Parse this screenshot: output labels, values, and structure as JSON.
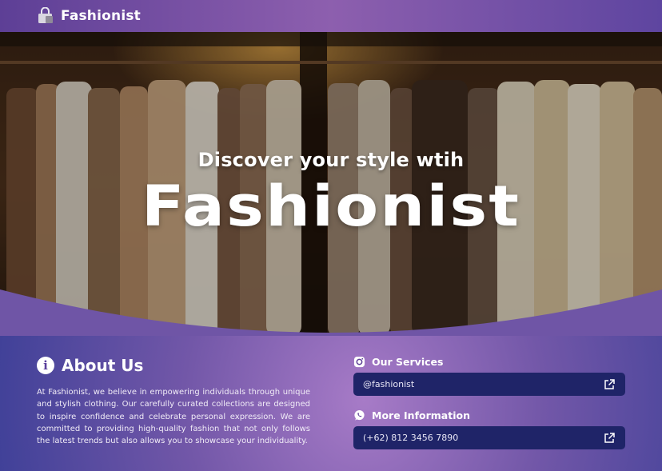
{
  "header": {
    "brand": "Fashionist"
  },
  "hero": {
    "subtitle": "Discover your style wtih",
    "title": "Fashionist"
  },
  "about": {
    "title": "About Us",
    "body": "At Fashionist, we believe in empowering individuals through unique and stylish clothing. Our carefully curated collections are designed to inspire confidence and celebrate personal expression. We are committed to providing high-quality fashion that not only follows the latest trends but also allows you to showcase your individuality."
  },
  "services": {
    "title": "Our Services",
    "handle": "@fashionist"
  },
  "more_info": {
    "title": "More Information",
    "phone": "(+62) 812 3456 7890"
  },
  "icons": {
    "logo": "shopping-bag-icon",
    "about": "info-icon",
    "services": "instagram-icon",
    "more_info": "whatsapp-icon",
    "link": "external-link-icon"
  },
  "colors": {
    "header": "#7a52a6",
    "link_box": "#1f2468",
    "accent_purple": "#8d5fae"
  }
}
